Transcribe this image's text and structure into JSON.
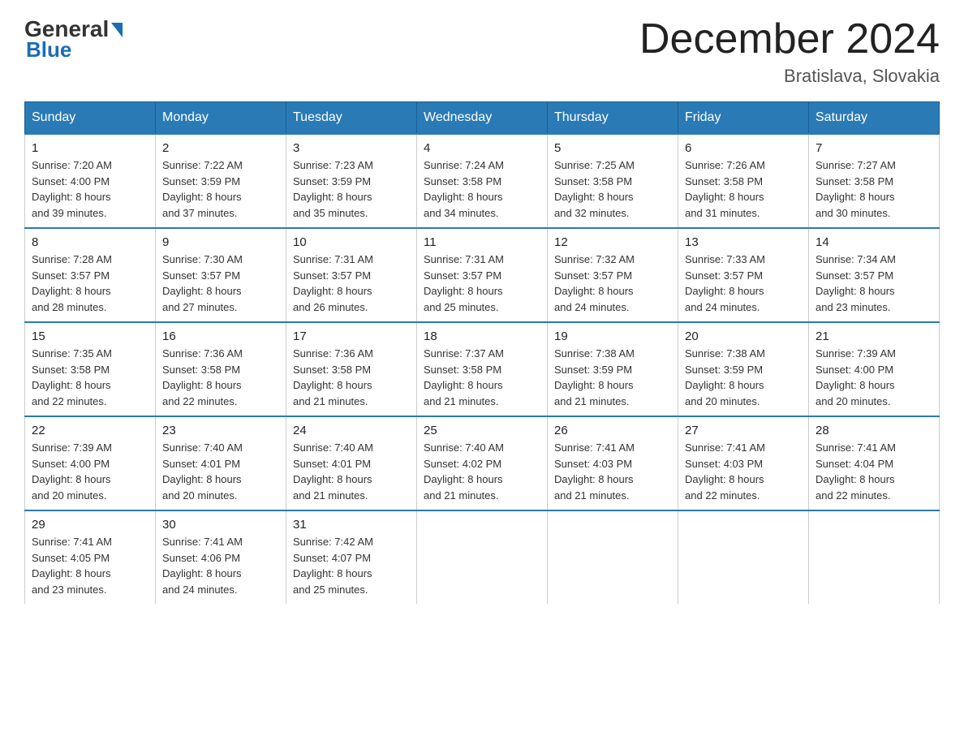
{
  "logo": {
    "general": "General",
    "arrow": "▶",
    "blue": "Blue"
  },
  "title": "December 2024",
  "location": "Bratislava, Slovakia",
  "days_of_week": [
    "Sunday",
    "Monday",
    "Tuesday",
    "Wednesday",
    "Thursday",
    "Friday",
    "Saturday"
  ],
  "weeks": [
    [
      {
        "day": "1",
        "sunrise": "7:20 AM",
        "sunset": "4:00 PM",
        "daylight": "8 hours and 39 minutes."
      },
      {
        "day": "2",
        "sunrise": "7:22 AM",
        "sunset": "3:59 PM",
        "daylight": "8 hours and 37 minutes."
      },
      {
        "day": "3",
        "sunrise": "7:23 AM",
        "sunset": "3:59 PM",
        "daylight": "8 hours and 35 minutes."
      },
      {
        "day": "4",
        "sunrise": "7:24 AM",
        "sunset": "3:58 PM",
        "daylight": "8 hours and 34 minutes."
      },
      {
        "day": "5",
        "sunrise": "7:25 AM",
        "sunset": "3:58 PM",
        "daylight": "8 hours and 32 minutes."
      },
      {
        "day": "6",
        "sunrise": "7:26 AM",
        "sunset": "3:58 PM",
        "daylight": "8 hours and 31 minutes."
      },
      {
        "day": "7",
        "sunrise": "7:27 AM",
        "sunset": "3:58 PM",
        "daylight": "8 hours and 30 minutes."
      }
    ],
    [
      {
        "day": "8",
        "sunrise": "7:28 AM",
        "sunset": "3:57 PM",
        "daylight": "8 hours and 28 minutes."
      },
      {
        "day": "9",
        "sunrise": "7:30 AM",
        "sunset": "3:57 PM",
        "daylight": "8 hours and 27 minutes."
      },
      {
        "day": "10",
        "sunrise": "7:31 AM",
        "sunset": "3:57 PM",
        "daylight": "8 hours and 26 minutes."
      },
      {
        "day": "11",
        "sunrise": "7:31 AM",
        "sunset": "3:57 PM",
        "daylight": "8 hours and 25 minutes."
      },
      {
        "day": "12",
        "sunrise": "7:32 AM",
        "sunset": "3:57 PM",
        "daylight": "8 hours and 24 minutes."
      },
      {
        "day": "13",
        "sunrise": "7:33 AM",
        "sunset": "3:57 PM",
        "daylight": "8 hours and 24 minutes."
      },
      {
        "day": "14",
        "sunrise": "7:34 AM",
        "sunset": "3:57 PM",
        "daylight": "8 hours and 23 minutes."
      }
    ],
    [
      {
        "day": "15",
        "sunrise": "7:35 AM",
        "sunset": "3:58 PM",
        "daylight": "8 hours and 22 minutes."
      },
      {
        "day": "16",
        "sunrise": "7:36 AM",
        "sunset": "3:58 PM",
        "daylight": "8 hours and 22 minutes."
      },
      {
        "day": "17",
        "sunrise": "7:36 AM",
        "sunset": "3:58 PM",
        "daylight": "8 hours and 21 minutes."
      },
      {
        "day": "18",
        "sunrise": "7:37 AM",
        "sunset": "3:58 PM",
        "daylight": "8 hours and 21 minutes."
      },
      {
        "day": "19",
        "sunrise": "7:38 AM",
        "sunset": "3:59 PM",
        "daylight": "8 hours and 21 minutes."
      },
      {
        "day": "20",
        "sunrise": "7:38 AM",
        "sunset": "3:59 PM",
        "daylight": "8 hours and 20 minutes."
      },
      {
        "day": "21",
        "sunrise": "7:39 AM",
        "sunset": "4:00 PM",
        "daylight": "8 hours and 20 minutes."
      }
    ],
    [
      {
        "day": "22",
        "sunrise": "7:39 AM",
        "sunset": "4:00 PM",
        "daylight": "8 hours and 20 minutes."
      },
      {
        "day": "23",
        "sunrise": "7:40 AM",
        "sunset": "4:01 PM",
        "daylight": "8 hours and 20 minutes."
      },
      {
        "day": "24",
        "sunrise": "7:40 AM",
        "sunset": "4:01 PM",
        "daylight": "8 hours and 21 minutes."
      },
      {
        "day": "25",
        "sunrise": "7:40 AM",
        "sunset": "4:02 PM",
        "daylight": "8 hours and 21 minutes."
      },
      {
        "day": "26",
        "sunrise": "7:41 AM",
        "sunset": "4:03 PM",
        "daylight": "8 hours and 21 minutes."
      },
      {
        "day": "27",
        "sunrise": "7:41 AM",
        "sunset": "4:03 PM",
        "daylight": "8 hours and 22 minutes."
      },
      {
        "day": "28",
        "sunrise": "7:41 AM",
        "sunset": "4:04 PM",
        "daylight": "8 hours and 22 minutes."
      }
    ],
    [
      {
        "day": "29",
        "sunrise": "7:41 AM",
        "sunset": "4:05 PM",
        "daylight": "8 hours and 23 minutes."
      },
      {
        "day": "30",
        "sunrise": "7:41 AM",
        "sunset": "4:06 PM",
        "daylight": "8 hours and 24 minutes."
      },
      {
        "day": "31",
        "sunrise": "7:42 AM",
        "sunset": "4:07 PM",
        "daylight": "8 hours and 25 minutes."
      },
      null,
      null,
      null,
      null
    ]
  ],
  "labels": {
    "sunrise": "Sunrise:",
    "sunset": "Sunset:",
    "daylight": "Daylight:"
  }
}
